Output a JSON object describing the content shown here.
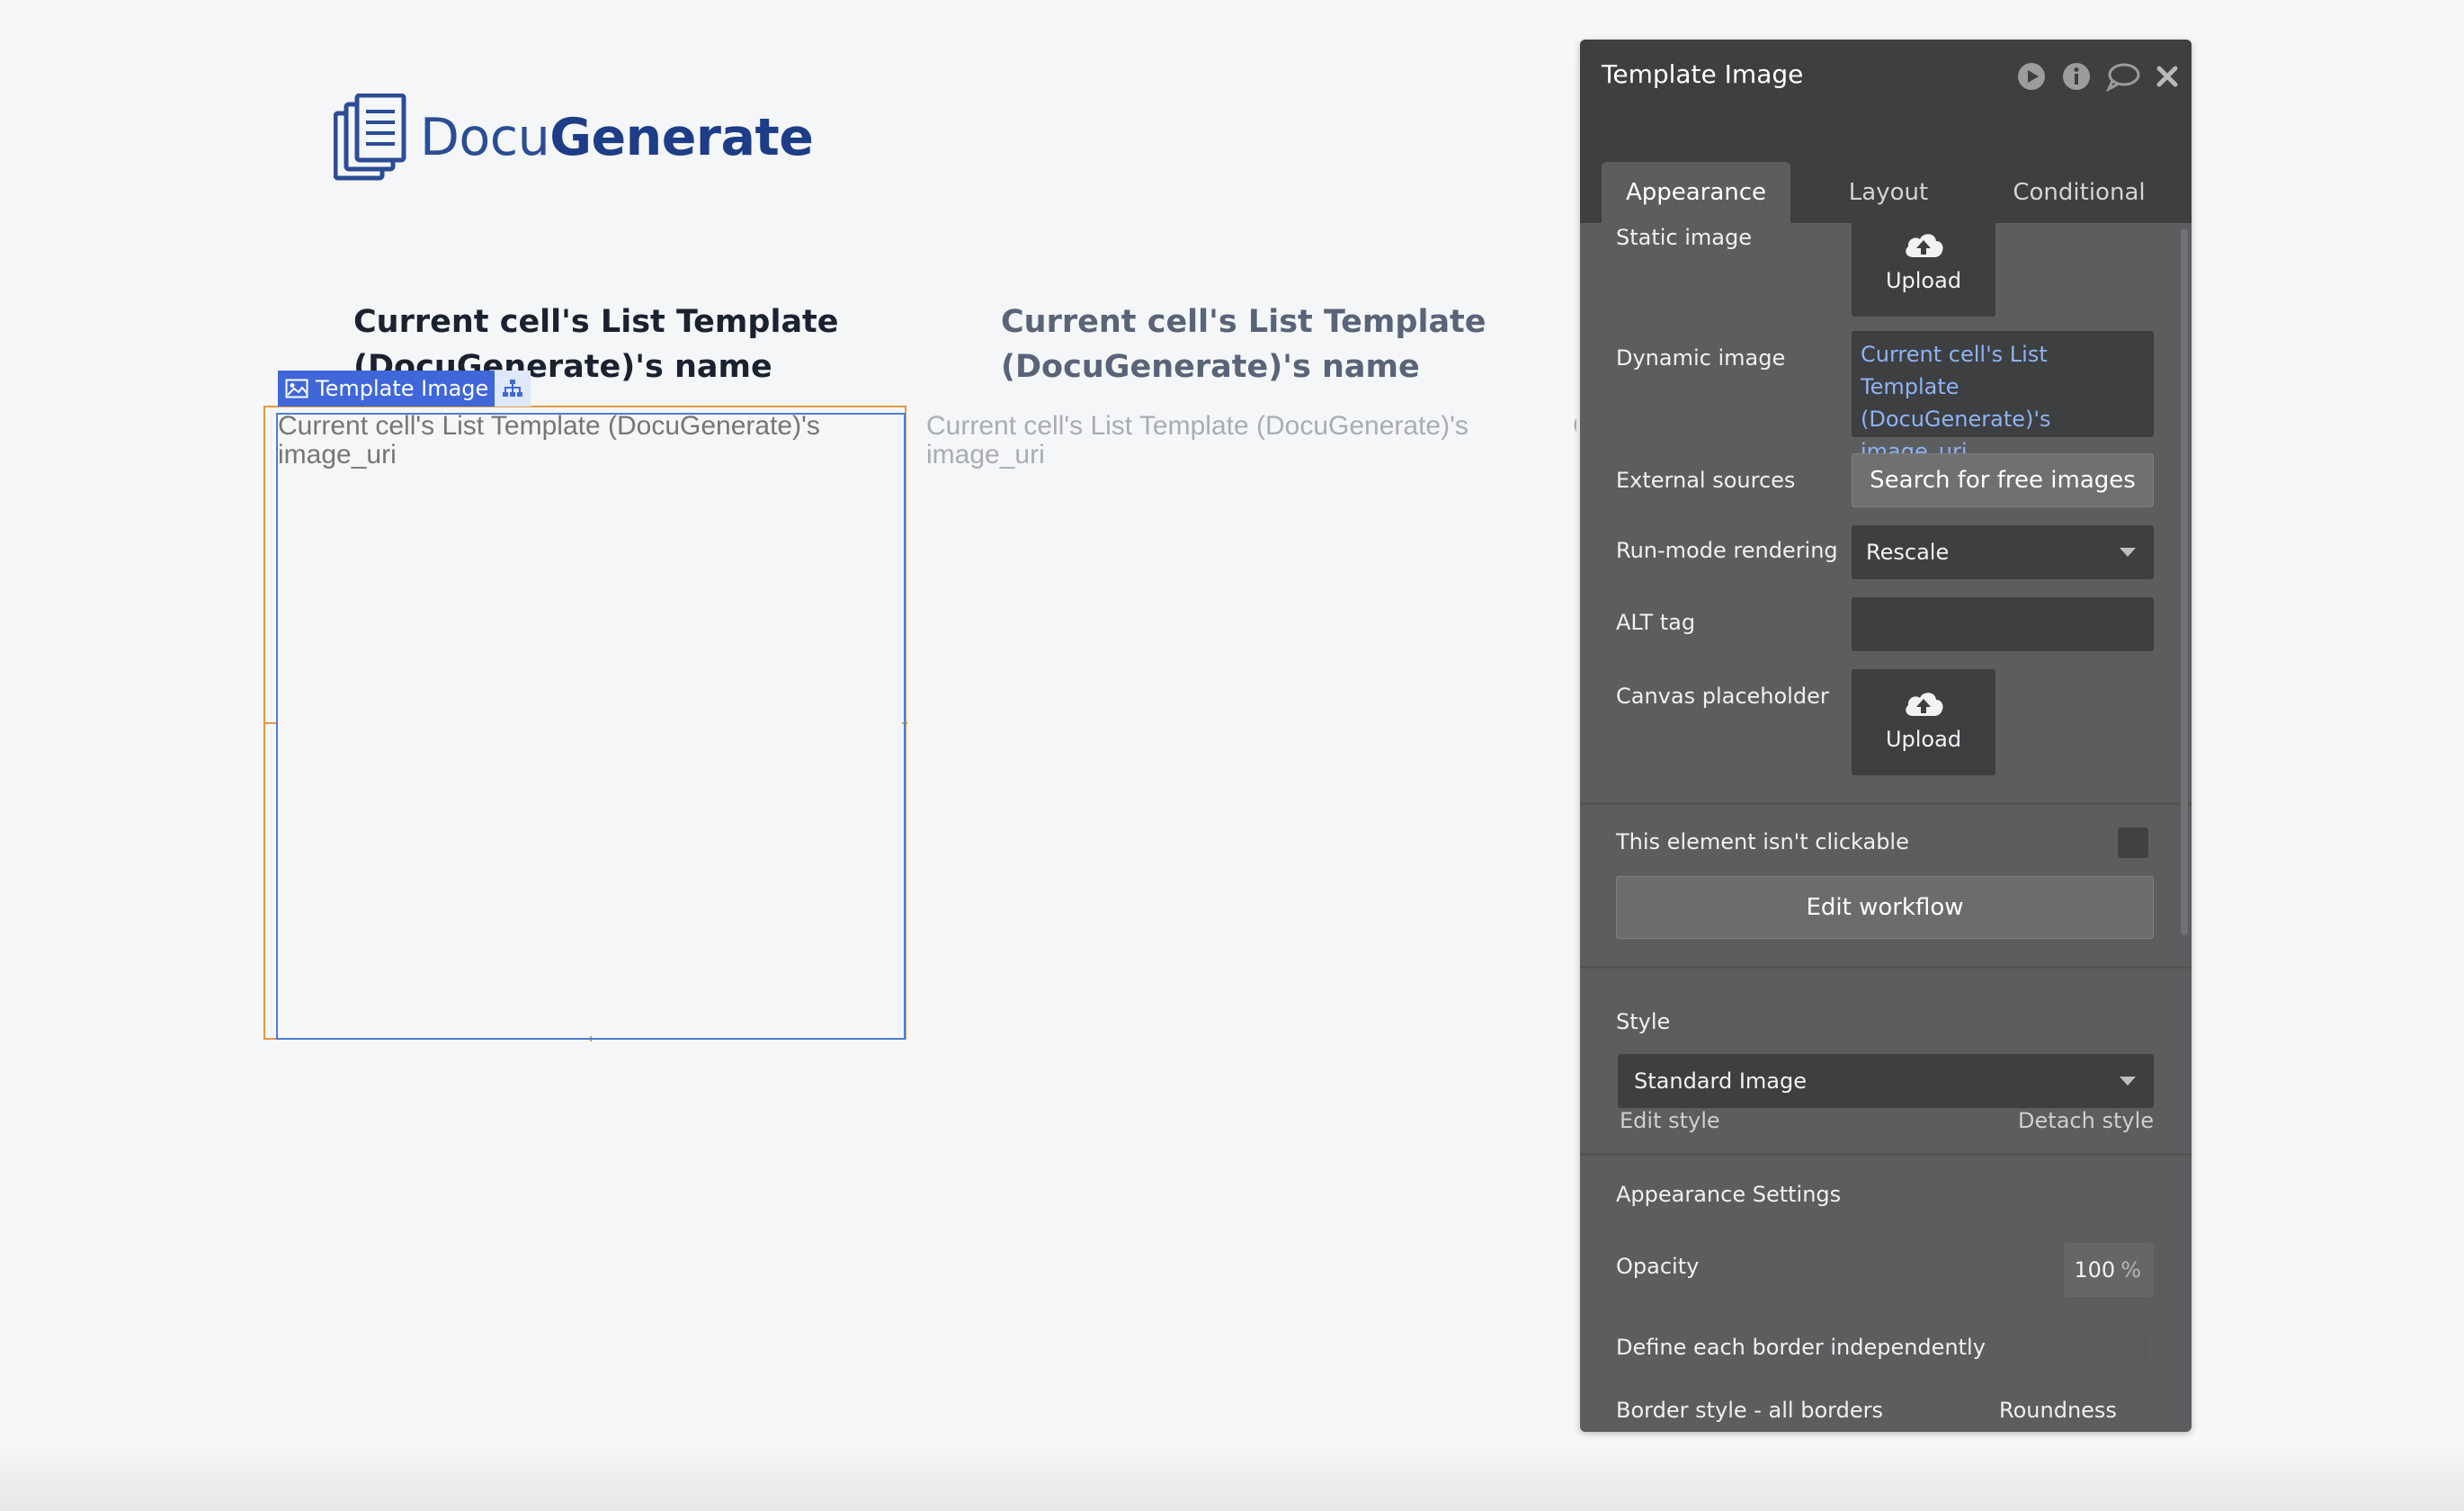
{
  "canvas": {
    "logo": {
      "text_light": "Docu",
      "text_bold": "Generate"
    },
    "cells": [
      {
        "title": "Current cell's List Template (DocuGenerate)'s name",
        "image_text": "Current cell's List Template (DocuGenerate)'s image_uri"
      },
      {
        "title": "Current cell's List Template (DocuGenerate)'s name",
        "image_text": "Current cell's List Template (DocuGenerate)'s image_uri"
      }
    ],
    "clipped_text": "Ci",
    "element_tag": "Template Image"
  },
  "panel": {
    "title": "Template Image",
    "tabs": [
      "Appearance",
      "Layout",
      "Conditional"
    ],
    "active_tab": "Appearance",
    "static_image": {
      "label": "Static image",
      "button": "Upload"
    },
    "dynamic_image": {
      "label": "Dynamic image",
      "value": "Current cell's List Template (DocuGenerate)'s image_uri"
    },
    "external_sources": {
      "label": "External sources",
      "button": "Search for free images"
    },
    "run_mode": {
      "label": "Run-mode rendering",
      "value": "Rescale"
    },
    "alt_tag": {
      "label": "ALT tag",
      "value": ""
    },
    "canvas_placeholder": {
      "label": "Canvas placeholder",
      "button": "Upload"
    },
    "not_clickable": {
      "label": "This element isn't clickable",
      "checked": false
    },
    "edit_workflow": "Edit workflow",
    "style": {
      "label": "Style",
      "value": "Standard Image",
      "edit": "Edit style",
      "detach": "Detach style"
    },
    "appearance_settings": "Appearance Settings",
    "opacity": {
      "label": "Opacity",
      "value": "100",
      "unit": "%"
    },
    "define_border": {
      "label": "Define each border independently",
      "checked": false
    },
    "border_style": "Border style - all borders",
    "roundness": "Roundness"
  },
  "colors": {
    "logo_blue": "#1d3d86",
    "panel_bg": "#5b5d5f",
    "panel_header": "#3d3f41",
    "dynamic_link": "#8fb3f3",
    "selection_orange": "#e39a45",
    "selection_blue": "#4b7fd1"
  }
}
